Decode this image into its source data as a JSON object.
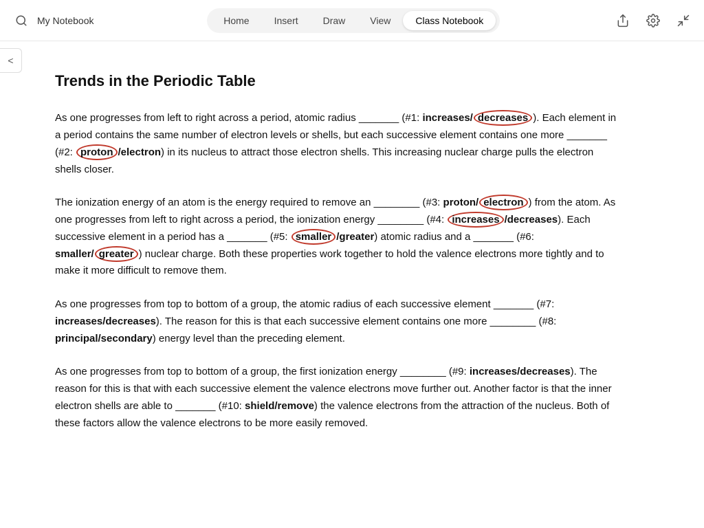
{
  "topbar": {
    "my_notebook": "My Notebook",
    "nav_items": [
      "Home",
      "Insert",
      "Draw",
      "View",
      "Class Notebook"
    ],
    "active_nav": "Class Notebook"
  },
  "sidebar": {
    "toggle_label": "<"
  },
  "document": {
    "title": "Trends in the Periodic Table",
    "paragraphs": [
      {
        "id": "p1",
        "segments": [
          {
            "type": "text",
            "content": "As one progresses from left to right across a period, atomic radius _______ (#1: "
          },
          {
            "type": "bold-circled-pair",
            "first": "increases",
            "second": "decreases",
            "circled": "decreases"
          },
          {
            "type": "text",
            "content": "). Each element in a period contains the same number of electron levels or shells, but each successive element contains one more _______ (#2: "
          },
          {
            "type": "bold-circled-pair",
            "first": "proton",
            "second": "electron",
            "circled": "proton"
          },
          {
            "type": "text",
            "content": ") in its nucleus to attract those electron shells. This increasing nuclear charge pulls the electron shells closer."
          }
        ]
      },
      {
        "id": "p2",
        "segments": [
          {
            "type": "text",
            "content": "The ionization energy of an atom is the energy required to remove an ________ (#3: "
          },
          {
            "type": "bold-circled-pair",
            "first": "proton",
            "second": "electron",
            "circled": "electron"
          },
          {
            "type": "text",
            "content": ") from the atom. As one progresses from left to right across a period, the ionization energy ________ (#4: "
          },
          {
            "type": "bold-circled-pair",
            "first": "increases",
            "second": "decreases",
            "circled": "increases"
          },
          {
            "type": "text",
            "content": "). Each successive element in a period has a _______ (#5: "
          },
          {
            "type": "bold-circled-pair",
            "first": "smaller",
            "second": "greater",
            "circled": "smaller"
          },
          {
            "type": "text",
            "content": ") atomic radius and a _______ (#6: "
          },
          {
            "type": "bold-circled-pair",
            "first": "smaller",
            "second": "greater",
            "circled": "greater"
          },
          {
            "type": "text",
            "content": ") nuclear charge. Both these properties work together to hold the valence electrons more tightly and to make it more difficult to remove them."
          }
        ]
      },
      {
        "id": "p3",
        "segments": [
          {
            "type": "text",
            "content": "As one progresses from top to bottom of a group, the atomic radius of each successive element _______ (#7: "
          },
          {
            "type": "bold-pair",
            "first": "increases",
            "second": "decreases"
          },
          {
            "type": "text",
            "content": "). The reason for this is that each successive element contains one more ________ (#8: "
          },
          {
            "type": "bold-pair",
            "first": "principal",
            "second": "secondary"
          },
          {
            "type": "text",
            "content": ") energy level than the preceding element."
          }
        ]
      },
      {
        "id": "p4",
        "segments": [
          {
            "type": "text",
            "content": "As one progresses from top to bottom of a group, the first ionization energy ________ (#9: "
          },
          {
            "type": "bold-pair",
            "first": "increases",
            "second": "decreases"
          },
          {
            "type": "text",
            "content": "). The reason for this is that with each successive element the valence electrons move further out. Another factor is that the inner electron shells are able to _______ (#10: "
          },
          {
            "type": "bold-pair",
            "first": "shield",
            "second": "remove"
          },
          {
            "type": "text",
            "content": ") the valence electrons from the attraction of the nucleus. Both of these factors allow the valence electrons to be more easily removed."
          }
        ]
      }
    ]
  }
}
